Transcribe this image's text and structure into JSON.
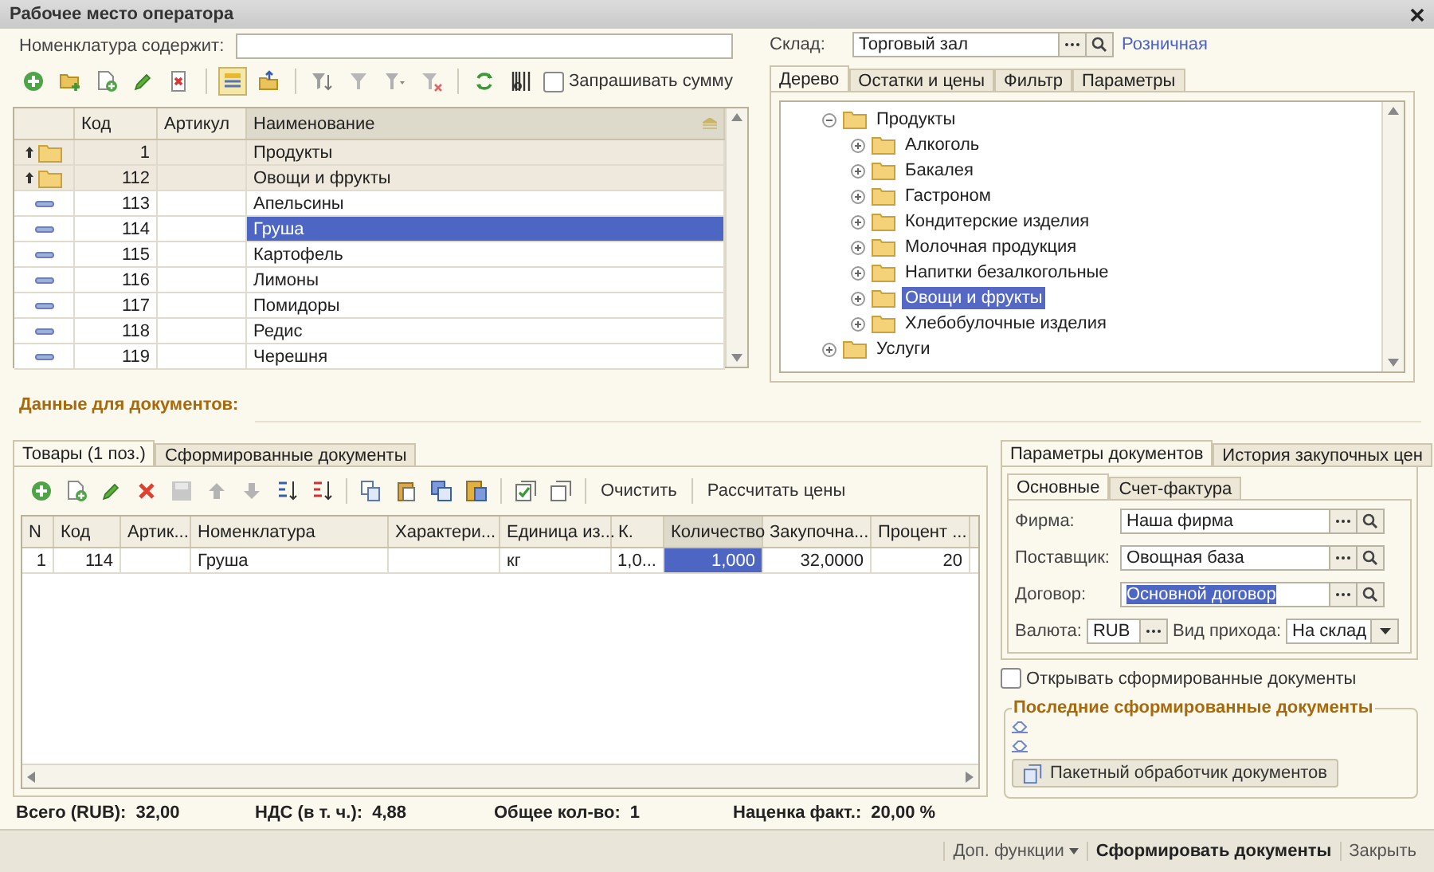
{
  "window": {
    "title": "Рабочее место оператора"
  },
  "search": {
    "label": "Номенклатура содержит:"
  },
  "ask_sum": {
    "label": "Запрашивать сумму",
    "checked": false
  },
  "items_table": {
    "columns": [
      "Код",
      "Артикул",
      "Наименование"
    ],
    "rows": [
      {
        "kind": "group",
        "code": "1",
        "name": "Продукты",
        "selected": false
      },
      {
        "kind": "group",
        "code": "112",
        "name": "Овощи и фрукты",
        "selected": false
      },
      {
        "kind": "item",
        "code": "113",
        "name": "Апельсины",
        "selected": false
      },
      {
        "kind": "item",
        "code": "114",
        "name": "Груша",
        "selected": true
      },
      {
        "kind": "item",
        "code": "115",
        "name": "Картофель",
        "selected": false
      },
      {
        "kind": "item",
        "code": "116",
        "name": "Лимоны",
        "selected": false
      },
      {
        "kind": "item",
        "code": "117",
        "name": "Помидоры",
        "selected": false
      },
      {
        "kind": "item",
        "code": "118",
        "name": "Редис",
        "selected": false
      },
      {
        "kind": "item",
        "code": "119",
        "name": "Черешня",
        "selected": false
      }
    ]
  },
  "warehouse": {
    "label": "Склад:",
    "value": "Торговый зал",
    "link": "Розничная"
  },
  "tree_tabs": [
    {
      "label": "Дерево",
      "selected": true
    },
    {
      "label": "Остатки и цены",
      "selected": false
    },
    {
      "label": "Фильтр",
      "selected": false
    },
    {
      "label": "Параметры",
      "selected": false
    }
  ],
  "tree": [
    {
      "label": "Продукты",
      "expanded": true,
      "selected": false,
      "children": [
        {
          "label": "Алкоголь",
          "expanded": false,
          "selected": false
        },
        {
          "label": "Бакалея",
          "expanded": false,
          "selected": false
        },
        {
          "label": "Гастроном",
          "expanded": false,
          "selected": false
        },
        {
          "label": "Кондитерские изделия",
          "expanded": false,
          "selected": false
        },
        {
          "label": "Молочная продукция",
          "expanded": false,
          "selected": false
        },
        {
          "label": "Напитки безалкогольные",
          "expanded": false,
          "selected": false
        },
        {
          "label": "Овощи и фрукты",
          "expanded": false,
          "selected": true
        },
        {
          "label": "Хлебобулочные изделия",
          "expanded": false,
          "selected": false
        }
      ]
    },
    {
      "label": "Услуги",
      "expanded": false,
      "selected": false
    }
  ],
  "documents_section": {
    "title": "Данные для документов:"
  },
  "doc_tabs": [
    {
      "label": "Товары (1 поз.)",
      "selected": true
    },
    {
      "label": "Сформированные документы",
      "selected": false
    }
  ],
  "doc_toolbar": {
    "buttons": [
      "Очистить",
      "Рассчитать цены"
    ]
  },
  "doc_table": {
    "columns": [
      "N",
      "Код",
      "Артик...",
      "Номенклатура",
      "Характери...",
      "Единица из...",
      "К.",
      "Количество",
      "Закупочна...",
      "Процент ..."
    ],
    "rows": [
      {
        "n": "1",
        "code": "114",
        "name": "Груша",
        "unit": "кг",
        "k": "1,0...",
        "quantity": "1,000",
        "price": "32,0000",
        "percent": "20"
      }
    ]
  },
  "totals": [
    {
      "label": "Всего (RUB):",
      "value": "32,00"
    },
    {
      "label": "НДС (в т. ч.):",
      "value": "4,88"
    },
    {
      "label": "Общее кол-во:",
      "value": "1"
    },
    {
      "label": "Наценка факт.:",
      "value": "20,00 %"
    }
  ],
  "params_tabs": [
    {
      "label": "Параметры документов",
      "selected": true
    },
    {
      "label": "История закупочных цен",
      "selected": false
    }
  ],
  "params_subtabs": [
    {
      "label": "Основные",
      "selected": true
    },
    {
      "label": "Счет-фактура",
      "selected": false
    }
  ],
  "params_fields": [
    {
      "label": "Фирма:",
      "value": "Наша фирма",
      "selected": false
    },
    {
      "label": "Поставщик:",
      "value": "Овощная база",
      "selected": false
    },
    {
      "label": "Договор:",
      "value": "Основной договор",
      "selected": true
    }
  ],
  "currency": {
    "label": "Валюта:",
    "value": "RUB"
  },
  "receipt_type": {
    "label": "Вид прихода:",
    "value": "На склад"
  },
  "open_documents": {
    "label": "Открывать сформированные документы",
    "checked": false
  },
  "recent_documents": {
    "title": "Последние сформированные документы",
    "button": "Пакетный обработчик документов"
  },
  "footer": {
    "buttons": [
      {
        "label": "Доп. функции",
        "kind": "menu"
      },
      {
        "label": "Сформировать документы",
        "kind": "default"
      },
      {
        "label": "Закрыть",
        "kind": "plain"
      }
    ]
  }
}
